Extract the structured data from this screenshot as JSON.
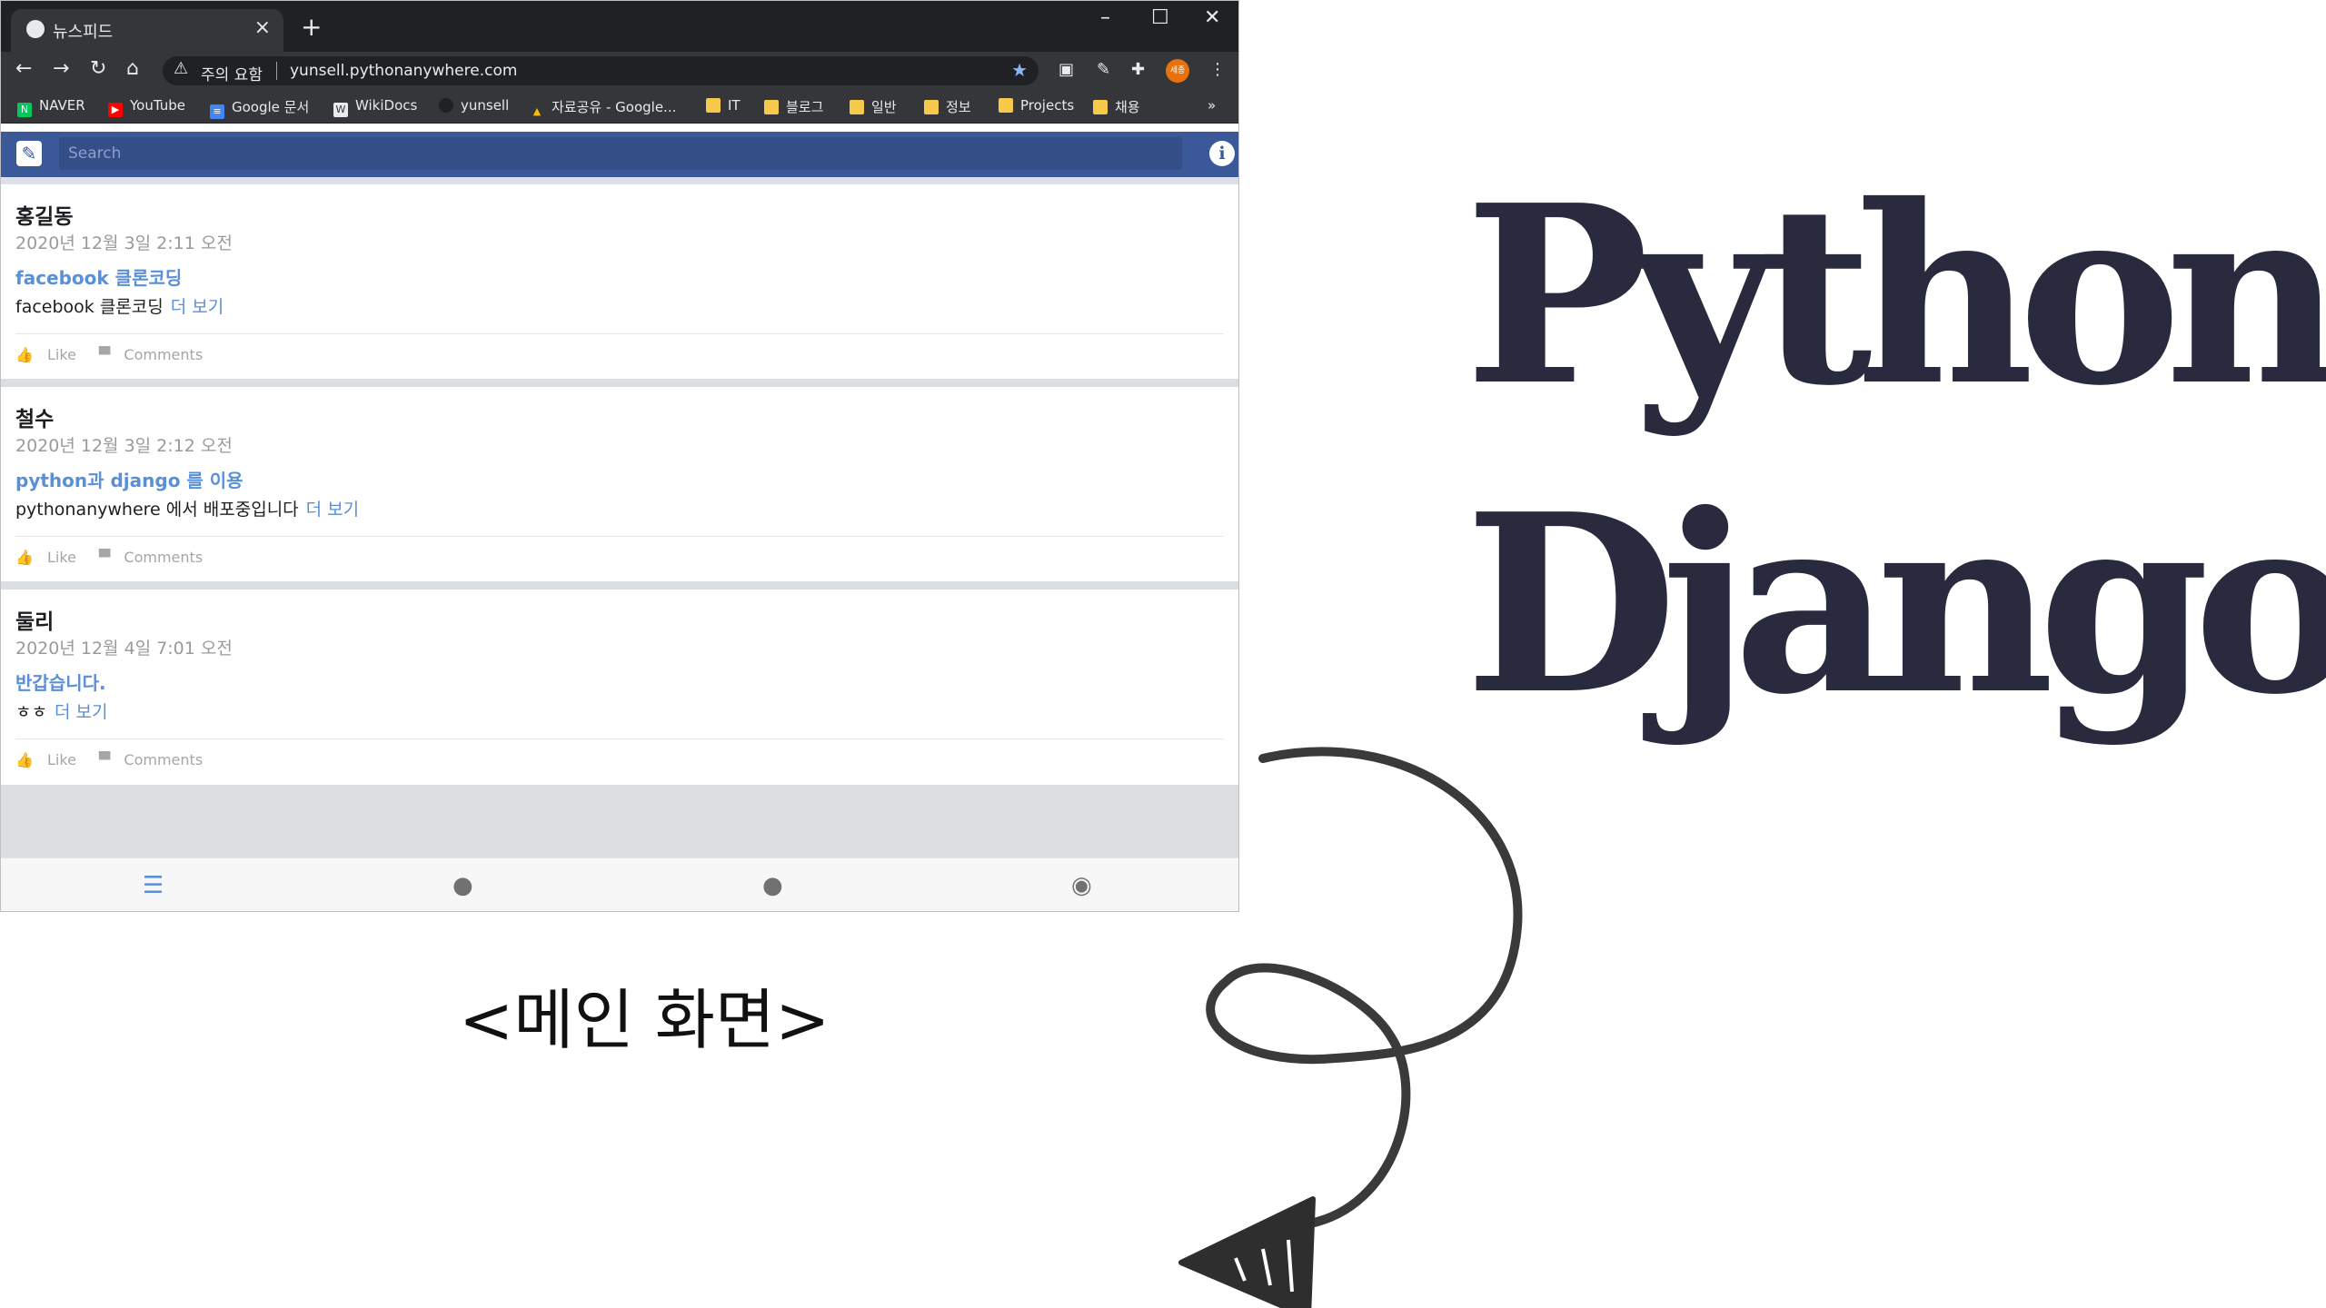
{
  "browser": {
    "tab_title": "뉴스피드",
    "tab_close": "×",
    "new_tab": "+",
    "window_controls": [
      "–",
      "☐",
      "✕"
    ],
    "security_label": "주의 요함",
    "url": "yunsell.pythonanywhere.com",
    "profile_badge": "세종",
    "bookmarks": [
      {
        "label": "NAVER",
        "icon": "naver-icon"
      },
      {
        "label": "YouTube",
        "icon": "youtube-icon"
      },
      {
        "label": "Google 문서",
        "icon": "google-docs-icon"
      },
      {
        "label": "WikiDocs",
        "icon": "wikidocs-icon"
      },
      {
        "label": "yunsell",
        "icon": "github-icon"
      },
      {
        "label": "자료공유 - Google...",
        "icon": "google-drive-icon"
      },
      {
        "label": "IT",
        "icon": "folder-icon"
      },
      {
        "label": "블로그",
        "icon": "folder-icon"
      },
      {
        "label": "일반",
        "icon": "folder-icon"
      },
      {
        "label": "정보",
        "icon": "folder-icon"
      },
      {
        "label": "Projects",
        "icon": "folder-icon"
      },
      {
        "label": "채용",
        "icon": "folder-icon"
      }
    ],
    "bookmarks_overflow": "»"
  },
  "app": {
    "search_placeholder": "Search",
    "posts": [
      {
        "author": "홍길동",
        "time": "2020년 12월 3일 2:11 오전",
        "title": "facebook 클론코딩",
        "body": "facebook 클론코딩",
        "more": "더 보기",
        "like": "Like",
        "comments": "Comments"
      },
      {
        "author": "철수",
        "time": "2020년 12월 3일 2:12 오전",
        "title": "python과 django 를 이용",
        "body": "pythonanywhere 에서 배포중입니다",
        "more": "더 보기",
        "like": "Like",
        "comments": "Comments"
      },
      {
        "author": "둘리",
        "time": "2020년 12월 4일 7:01 오전",
        "title": "반갑습니다.",
        "body": "ㅎㅎ",
        "more": "더 보기",
        "like": "Like",
        "comments": "Comments"
      }
    ],
    "bottom_nav": [
      "newsfeed-icon",
      "profile-icon",
      "friends-icon",
      "globe-icon"
    ]
  },
  "slide": {
    "caption": "<메인 화면>",
    "logo_line1": "Python",
    "logo_line2": "Django"
  },
  "colors": {
    "brand": "#3b5998",
    "link": "#5b8fd6",
    "logo": "#2a2a3e"
  }
}
